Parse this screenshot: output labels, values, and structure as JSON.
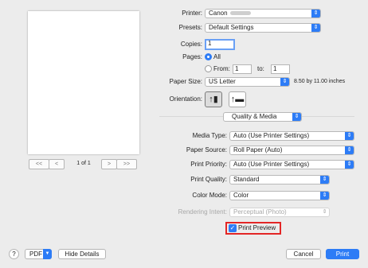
{
  "preview": {
    "first_label": "<<",
    "prev_label": "<",
    "page_indicator": "1 of 1",
    "next_label": ">",
    "last_label": ">>"
  },
  "printer": {
    "label": "Printer:",
    "value": "Canon"
  },
  "presets": {
    "label": "Presets:",
    "value": "Default Settings"
  },
  "copies": {
    "label": "Copies:",
    "value": "1"
  },
  "pages": {
    "label": "Pages:",
    "all_label": "All",
    "from_label": "From:",
    "from_value": "1",
    "to_label": "to:",
    "to_value": "1",
    "selected": "All"
  },
  "paper_size": {
    "label": "Paper Size:",
    "value": "US Letter",
    "dimensions": "8.50 by 11.00 inches"
  },
  "orientation": {
    "label": "Orientation:"
  },
  "section": {
    "value": "Quality & Media"
  },
  "settings": {
    "media_type": {
      "label": "Media Type:",
      "value": "Auto (Use Printer Settings)"
    },
    "paper_source": {
      "label": "Paper Source:",
      "value": "Roll Paper (Auto)"
    },
    "print_priority": {
      "label": "Print Priority:",
      "value": "Auto (Use Printer Settings)"
    },
    "print_quality": {
      "label": "Print Quality:",
      "value": "Standard"
    },
    "color_mode": {
      "label": "Color Mode:",
      "value": "Color"
    },
    "rendering_intent": {
      "label": "Rendering Intent:",
      "value": "Perceptual (Photo)"
    }
  },
  "print_preview": {
    "label": "Print Preview",
    "checked": true
  },
  "footer": {
    "help_label": "?",
    "pdf_label": "PDF",
    "hide_details_label": "Hide Details",
    "cancel_label": "Cancel",
    "print_label": "Print"
  },
  "colors": {
    "accent": "#2d7cf6",
    "highlight": "#e32626",
    "background": "#ececec"
  }
}
